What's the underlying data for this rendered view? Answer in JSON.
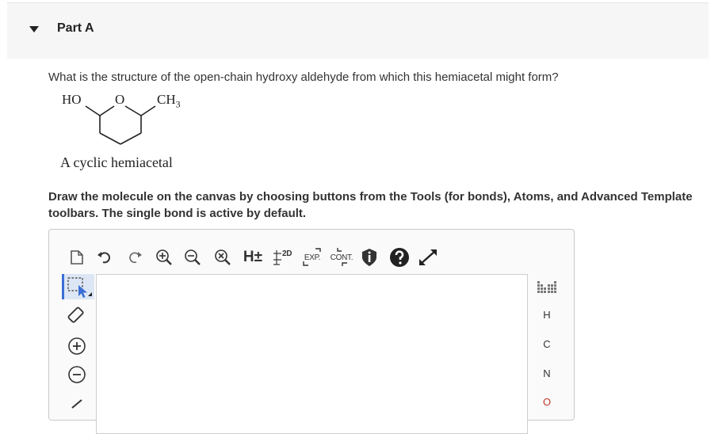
{
  "part": {
    "title": "Part A"
  },
  "question": "What is the structure of the open-chain hydroxy aldehyde from which this hemiacetal might form?",
  "molecule": {
    "labels": {
      "ho": "HO",
      "o": "O",
      "ch3": "CH",
      "ch3_sub": "3"
    },
    "caption": "A cyclic hemiacetal"
  },
  "instruction": "Draw the molecule on the canvas by choosing buttons from the Tools (for bonds), Atoms, and Advanced Template toolbars. The single bond is active by default.",
  "toolbar": {
    "h_label": "H±",
    "d2_label": "2D",
    "exp_label": "EXP.",
    "cont_label": "CONT."
  },
  "atoms": [
    "H",
    "C",
    "N",
    "O"
  ],
  "colors": {
    "accent": "#3a6fd6",
    "header_bg": "#f6f6f6"
  }
}
